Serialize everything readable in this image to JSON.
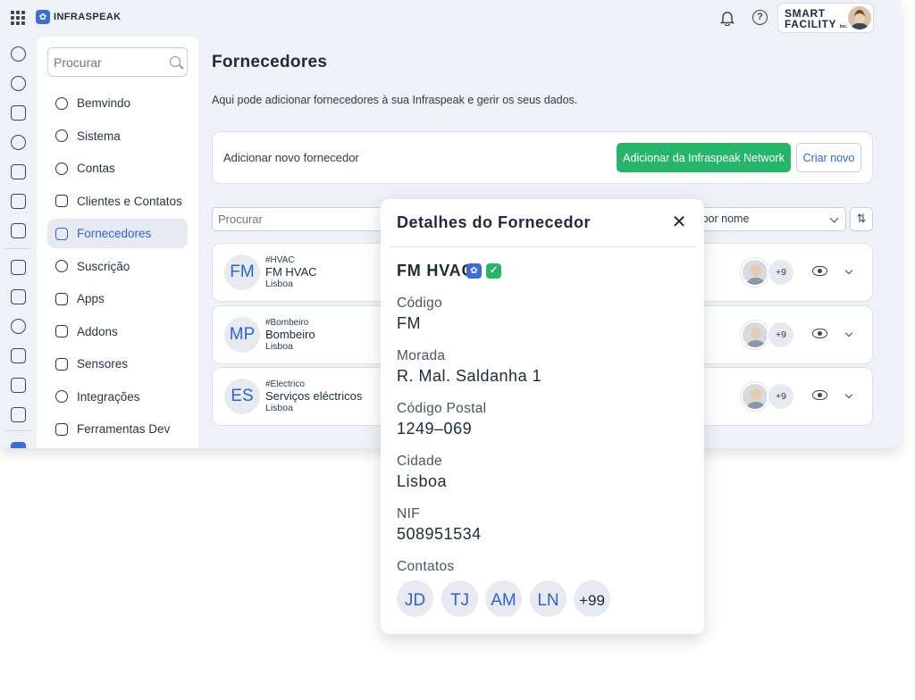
{
  "topbar": {
    "logo_text": "INFRASPEAK",
    "brand_line1": "SMART",
    "brand_line2": "FACILITY",
    "brand_suffix": "Inc."
  },
  "sidebar": {
    "search_placeholder": "Procurar",
    "items": [
      {
        "label": "Bemvindo",
        "icon": "smile-icon"
      },
      {
        "label": "Sistema",
        "icon": "gear-icon"
      },
      {
        "label": "Contas",
        "icon": "user-icon"
      },
      {
        "label": "Clientes e Contatos",
        "icon": "contacts-icon"
      },
      {
        "label": "Fornecedores",
        "icon": "truck-icon",
        "active": true
      },
      {
        "label": "Suscrição",
        "icon": "subscription-icon"
      },
      {
        "label": "Apps",
        "icon": "box-icon"
      },
      {
        "label": "Addons",
        "icon": "addons-icon"
      },
      {
        "label": "Sensores",
        "icon": "sensor-icon"
      },
      {
        "label": "Integrações",
        "icon": "plug-icon"
      },
      {
        "label": "Ferramentas Dev",
        "icon": "code-icon"
      }
    ]
  },
  "main": {
    "title": "Fornecedores",
    "subtitle": "Aqui pode adicionar fornecedores à sua Infraspeak e gerir os seus dados.",
    "add_label": "Adicionar novo fornecedor",
    "btn_network": "Adicionar da Infraspeak Network",
    "btn_new": "Criar novo",
    "filter_placeholder": "Procurar",
    "sort_label": "ar por nome",
    "suppliers": [
      {
        "initials": "FM",
        "tag": "#HVAC",
        "name": "FM HVAC",
        "city": "Lisboa",
        "more": "+9"
      },
      {
        "initials": "MP",
        "tag": "#Bombeiro",
        "name": "Bombeiro",
        "city": "Lisboa",
        "more": "+9"
      },
      {
        "initials": "ES",
        "tag": "#Electrico",
        "name": "Serviços eléctricos",
        "city": "Lisboa",
        "more": "+9"
      }
    ]
  },
  "modal": {
    "title": "Detalhes do Fornecedor",
    "close": "✕",
    "name": "FM HVAC",
    "fields": {
      "code_label": "Código",
      "code_value": "FM",
      "address_label": "Morada",
      "address_value": "R. Mal. Saldanha 1",
      "postal_label": "Código Postal",
      "postal_value": "1249–069",
      "city_label": "Cidade",
      "city_value": "Lisboa",
      "nif_label": "NIF",
      "nif_value": "508951534",
      "contacts_label": "Contatos"
    },
    "contacts": [
      "JD",
      "TJ",
      "AM",
      "LN"
    ],
    "contacts_more": "+99"
  },
  "colors": {
    "accent": "#2e62d6",
    "green": "#27b46b",
    "background": "#eef1f6"
  }
}
